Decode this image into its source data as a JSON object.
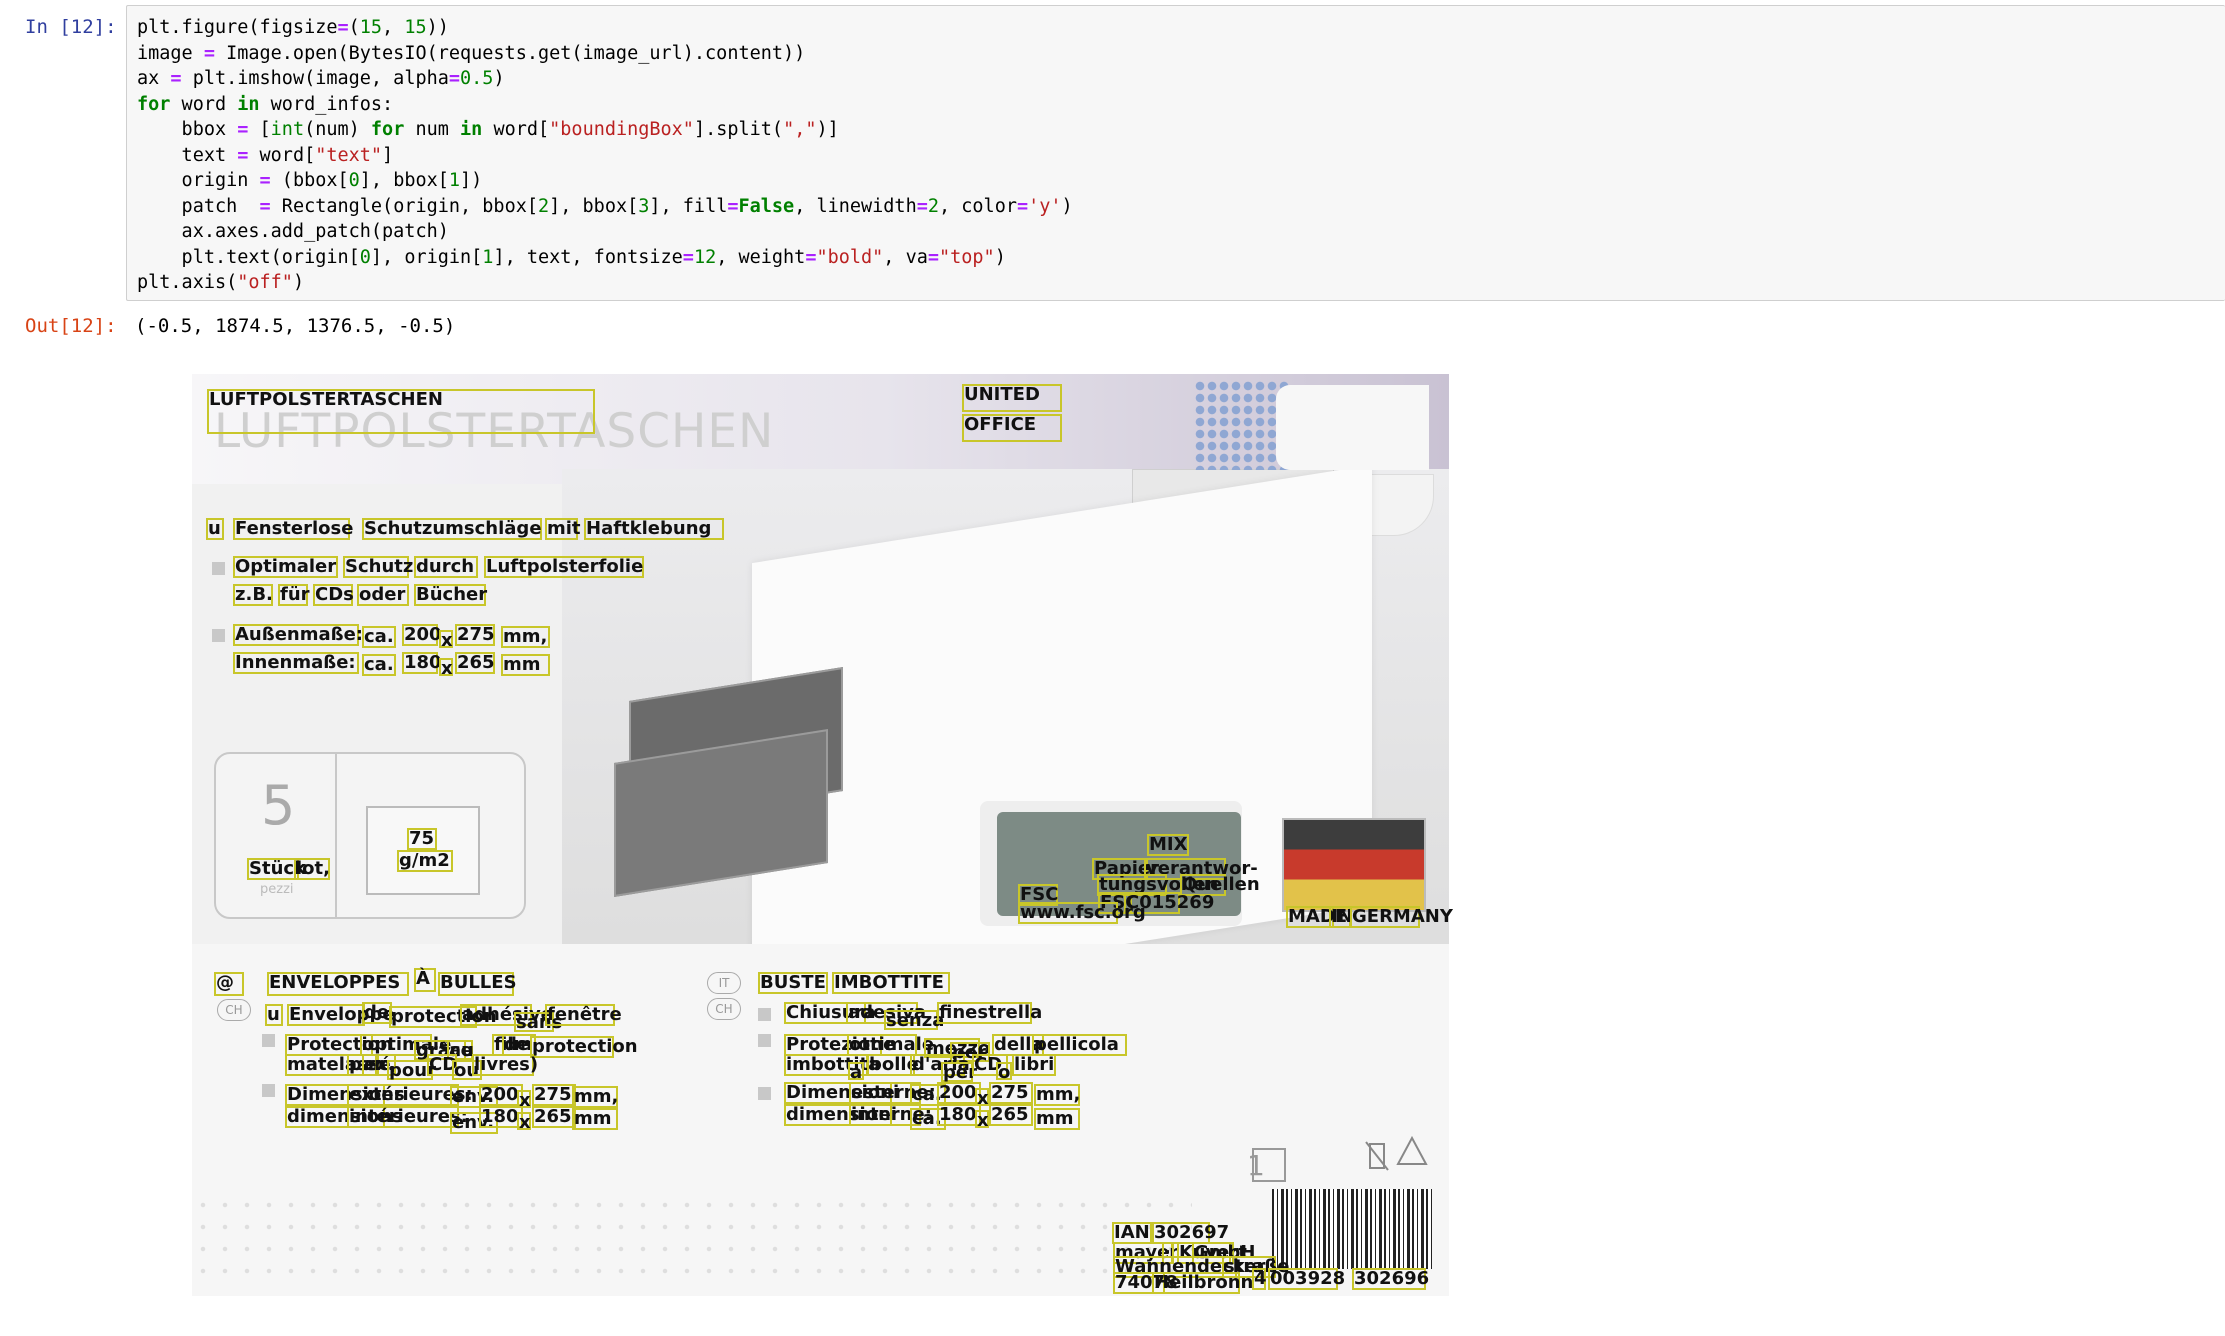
{
  "notebook": {
    "input_prompt": "In [12]:",
    "output_prompt": "Out[12]:",
    "code_lines": [
      [
        [
          "plain",
          "plt.figure(figsize"
        ],
        [
          "op",
          "="
        ],
        [
          "plain",
          "("
        ],
        [
          "num",
          "15"
        ],
        [
          "plain",
          ", "
        ],
        [
          "num",
          "15"
        ],
        [
          "plain",
          "))"
        ]
      ],
      [
        [
          "plain",
          "image "
        ],
        [
          "op",
          "="
        ],
        [
          "plain",
          " Image.open(BytesIO(requests.get(image_url).content))"
        ]
      ],
      [
        [
          "plain",
          "ax "
        ],
        [
          "op",
          "="
        ],
        [
          "plain",
          " plt.imshow(image, alpha"
        ],
        [
          "op",
          "="
        ],
        [
          "num",
          "0.5"
        ],
        [
          "plain",
          ")"
        ]
      ],
      [
        [
          "kw",
          "for"
        ],
        [
          "plain",
          " word "
        ],
        [
          "kw",
          "in"
        ],
        [
          "plain",
          " word_infos:"
        ]
      ],
      [
        [
          "plain",
          "    bbox "
        ],
        [
          "op",
          "="
        ],
        [
          "plain",
          " ["
        ],
        [
          "bi",
          "int"
        ],
        [
          "plain",
          "(num) "
        ],
        [
          "kw",
          "for"
        ],
        [
          "plain",
          " num "
        ],
        [
          "kw",
          "in"
        ],
        [
          "plain",
          " word["
        ],
        [
          "str",
          "\"boundingBox\""
        ],
        [
          "plain",
          "].split("
        ],
        [
          "str",
          "\",\""
        ],
        [
          "plain",
          ")]"
        ]
      ],
      [
        [
          "plain",
          "    text "
        ],
        [
          "op",
          "="
        ],
        [
          "plain",
          " word["
        ],
        [
          "str",
          "\"text\""
        ],
        [
          "plain",
          "]"
        ]
      ],
      [
        [
          "plain",
          "    origin "
        ],
        [
          "op",
          "="
        ],
        [
          "plain",
          " (bbox["
        ],
        [
          "num",
          "0"
        ],
        [
          "plain",
          "], bbox["
        ],
        [
          "num",
          "1"
        ],
        [
          "plain",
          "])"
        ]
      ],
      [
        [
          "plain",
          "    patch  "
        ],
        [
          "op",
          "="
        ],
        [
          "plain",
          " Rectangle(origin, bbox["
        ],
        [
          "num",
          "2"
        ],
        [
          "plain",
          "], bbox["
        ],
        [
          "num",
          "3"
        ],
        [
          "plain",
          "], fill"
        ],
        [
          "op",
          "="
        ],
        [
          "kw",
          "False"
        ],
        [
          "plain",
          ", linewidth"
        ],
        [
          "op",
          "="
        ],
        [
          "num",
          "2"
        ],
        [
          "plain",
          ", color"
        ],
        [
          "op",
          "="
        ],
        [
          "str",
          "'y'"
        ],
        [
          "plain",
          ")"
        ]
      ],
      [
        [
          "plain",
          "    ax.axes.add_patch(patch)"
        ]
      ],
      [
        [
          "plain",
          "    plt.text(origin["
        ],
        [
          "num",
          "0"
        ],
        [
          "plain",
          "], origin["
        ],
        [
          "num",
          "1"
        ],
        [
          "plain",
          "], text, fontsize"
        ],
        [
          "op",
          "="
        ],
        [
          "num",
          "12"
        ],
        [
          "plain",
          ", weight"
        ],
        [
          "op",
          "="
        ],
        [
          "str",
          "\"bold\""
        ],
        [
          "plain",
          ", va"
        ],
        [
          "op",
          "="
        ],
        [
          "str",
          "\"top\""
        ],
        [
          "plain",
          ")"
        ]
      ],
      [
        [
          "plain",
          "plt.axis("
        ],
        [
          "str",
          "\"off\""
        ],
        [
          "plain",
          ")"
        ]
      ]
    ],
    "output_text": "(-0.5, 1874.5, 1376.5, -0.5)"
  },
  "figure": {
    "background_text": {
      "title_faint": "LUFTPOLSTERTASCHEN",
      "logo_faint": "UNITED OFFICE",
      "pack_count": "5",
      "pack_pezzi": "pezzi",
      "lang_ch1": "CH",
      "lang_it": "IT",
      "lang_ch2": "CH",
      "box_count": "1"
    },
    "words": [
      {
        "t": "LUFTPOLSTERTASCHEN"
      },
      {
        "t": "UNITED"
      },
      {
        "t": "OFFICE"
      },
      {
        "t": "u"
      },
      {
        "t": "Fensterlose"
      },
      {
        "t": "Schutzumschläge"
      },
      {
        "t": "mit"
      },
      {
        "t": "Haftklebung"
      },
      {
        "t": "Optimaler"
      },
      {
        "t": "Schutz"
      },
      {
        "t": "durch"
      },
      {
        "t": "Luftpolsterfolie"
      },
      {
        "t": "z.B."
      },
      {
        "t": "für"
      },
      {
        "t": "CDs"
      },
      {
        "t": "oder"
      },
      {
        "t": "Bücher"
      },
      {
        "t": "Außenmaße:"
      },
      {
        "t": "ca."
      },
      {
        "t": "200"
      },
      {
        "t": "x"
      },
      {
        "t": "275"
      },
      {
        "t": "mm,"
      },
      {
        "t": "Innenmaße:"
      },
      {
        "t": "ca."
      },
      {
        "t": "180"
      },
      {
        "t": "x"
      },
      {
        "t": "265"
      },
      {
        "t": "mm"
      },
      {
        "t": "Stück"
      },
      {
        "t": "lot,"
      },
      {
        "t": "75"
      },
      {
        "t": "g/m2"
      },
      {
        "t": "MIX"
      },
      {
        "t": "Papier"
      },
      {
        "t": "verantwor-"
      },
      {
        "t": "tungsvollen"
      },
      {
        "t": "Quellen"
      },
      {
        "t": "FSC"
      },
      {
        "t": "FSC"
      },
      {
        "t": "C015269"
      },
      {
        "t": "www.fsc.org"
      },
      {
        "t": "MADE"
      },
      {
        "t": "IN"
      },
      {
        "t": "GERMANY"
      },
      {
        "t": "@"
      },
      {
        "t": "ENVELOPPES"
      },
      {
        "t": "À"
      },
      {
        "t": "BULLES"
      },
      {
        "t": "u"
      },
      {
        "t": "Enveloppe"
      },
      {
        "t": "de"
      },
      {
        "t": "protection"
      },
      {
        "t": "adhésive"
      },
      {
        "t": "sans"
      },
      {
        "t": "fenêtre"
      },
      {
        "t": "Protection"
      },
      {
        "t": "optimale"
      },
      {
        "t": "grâce"
      },
      {
        "t": "au"
      },
      {
        "t": "film"
      },
      {
        "t": "de"
      },
      {
        "t": "protection"
      },
      {
        "t": "matelassé,"
      },
      {
        "t": "par"
      },
      {
        "t": "ex."
      },
      {
        "t": "pour"
      },
      {
        "t": "CD"
      },
      {
        "t": "ou"
      },
      {
        "t": "livres)"
      },
      {
        "t": "Dimensions"
      },
      {
        "t": "extérieures:"
      },
      {
        "t": "env."
      },
      {
        "t": "200"
      },
      {
        "t": "x"
      },
      {
        "t": "275"
      },
      {
        "t": "mm,"
      },
      {
        "t": "dimensions"
      },
      {
        "t": "intérieures:"
      },
      {
        "t": "env."
      },
      {
        "t": "180"
      },
      {
        "t": "x"
      },
      {
        "t": "265"
      },
      {
        "t": "mm"
      },
      {
        "t": "BUSTE"
      },
      {
        "t": "IMBOTTITE"
      },
      {
        "t": "Chiusura"
      },
      {
        "t": "adesiva"
      },
      {
        "t": "senza"
      },
      {
        "t": "finestrella"
      },
      {
        "t": "Protezione"
      },
      {
        "t": "ottimale"
      },
      {
        "t": "mezzo"
      },
      {
        "t": "per"
      },
      {
        "t": "della"
      },
      {
        "t": "pellicola"
      },
      {
        "t": "imbottita"
      },
      {
        "t": "a"
      },
      {
        "t": "bolle"
      },
      {
        "t": "d'aria"
      },
      {
        "t": "per"
      },
      {
        "t": "CD"
      },
      {
        "t": "o"
      },
      {
        "t": "libri"
      },
      {
        "t": "Dimensioni"
      },
      {
        "t": "esterne:"
      },
      {
        "t": "ca."
      },
      {
        "t": "200"
      },
      {
        "t": "x"
      },
      {
        "t": "275"
      },
      {
        "t": "mm,"
      },
      {
        "t": "dimensioni"
      },
      {
        "t": "interne:"
      },
      {
        "t": "ca."
      },
      {
        "t": "180"
      },
      {
        "t": "x"
      },
      {
        "t": "265"
      },
      {
        "t": "mm"
      },
      {
        "t": "IAN"
      },
      {
        "t": "302697"
      },
      {
        "t": "mayer"
      },
      {
        "t": "·"
      },
      {
        "t": "Kuvert"
      },
      {
        "t": "GmbH"
      },
      {
        "t": "Wannendecker"
      },
      {
        "t": "straße"
      },
      {
        "t": "74078"
      },
      {
        "t": "Heilbronn"
      },
      {
        "t": "4"
      },
      {
        "t": "003928"
      },
      {
        "t": "302696"
      }
    ]
  },
  "colors": {
    "prompt_in": "#303f9f",
    "prompt_out": "#d84315",
    "bbox_stroke": "#c8c62a",
    "cell_background": "#f7f7f7"
  }
}
